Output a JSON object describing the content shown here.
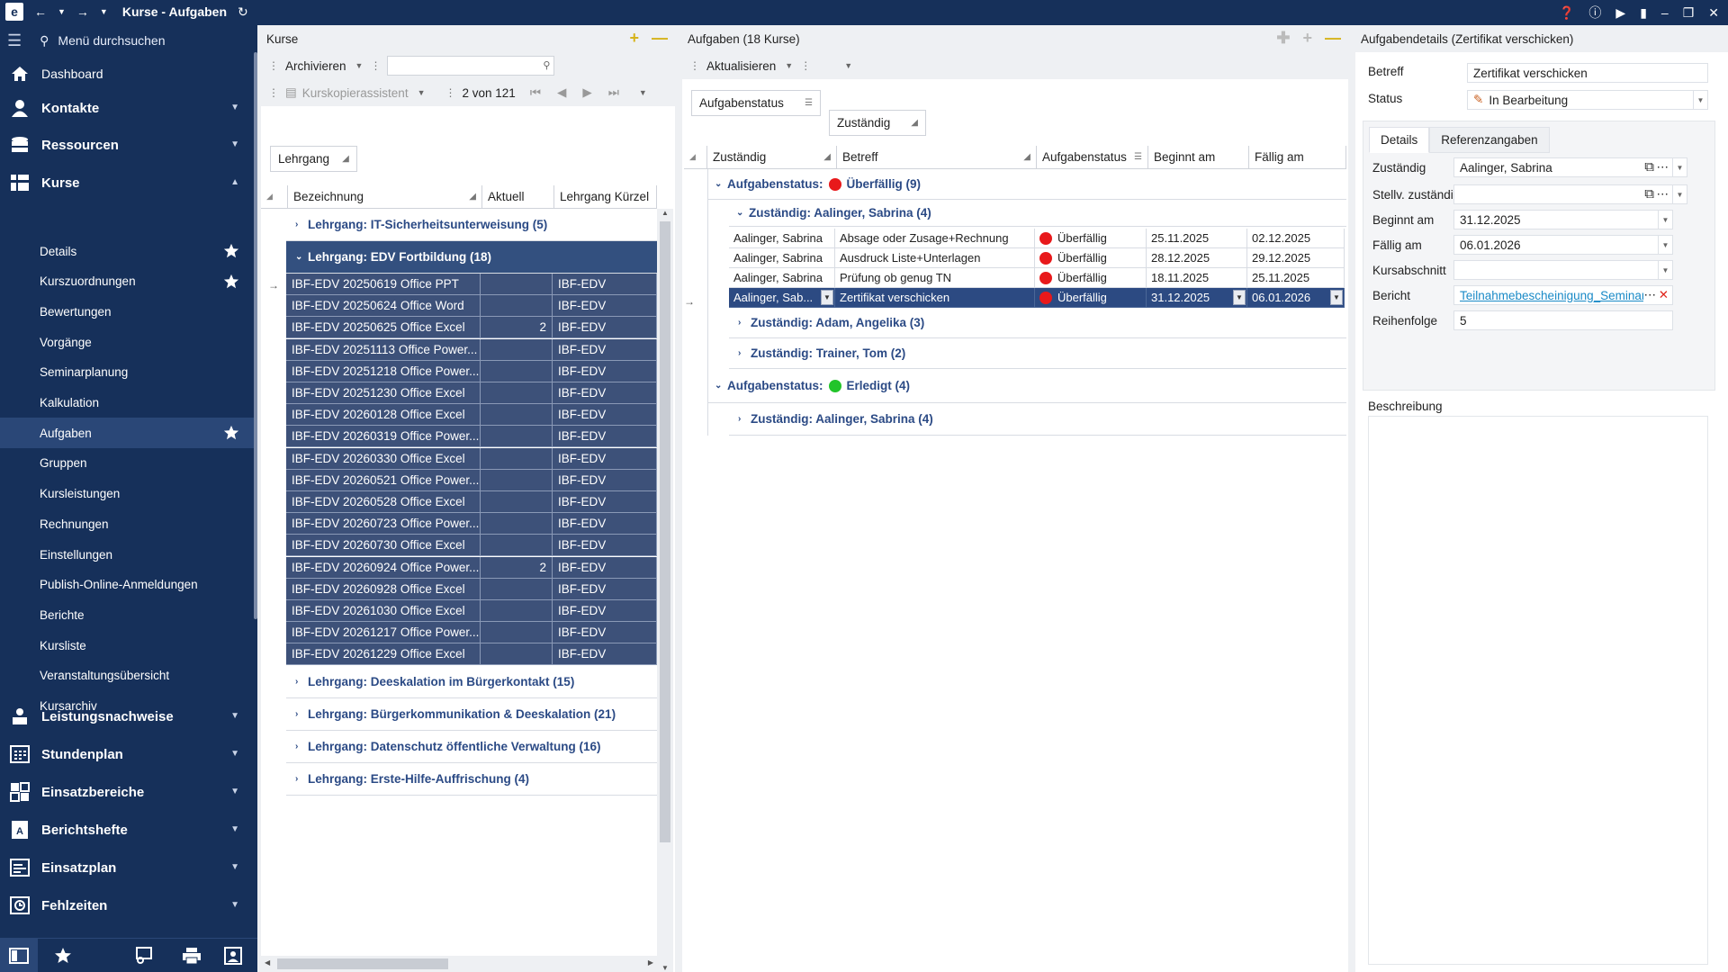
{
  "window": {
    "title": "Kurse - Aufgaben",
    "logo": "e"
  },
  "sidebar": {
    "search_label": "Menü durchsuchen",
    "dashboard": "Dashboard",
    "main_items": [
      {
        "label": "Kontakte",
        "icon": "contact-icon"
      },
      {
        "label": "Ressourcen",
        "icon": "database-icon"
      },
      {
        "label": "Kurse",
        "icon": "courses-icon"
      },
      {
        "label": "Leistungsnachweise",
        "icon": "certificate-icon"
      },
      {
        "label": "Stundenplan",
        "icon": "calendar-icon"
      },
      {
        "label": "Einsatzbereiche",
        "icon": "grid-icon"
      },
      {
        "label": "Berichtshefte",
        "icon": "report-book-icon"
      },
      {
        "label": "Einsatzplan",
        "icon": "plan-icon"
      },
      {
        "label": "Fehlzeiten",
        "icon": "absence-icon"
      }
    ],
    "sub_items": [
      "Details",
      "Kurszuordnungen",
      "Bewertungen",
      "Vorgänge",
      "Seminarplanung",
      "Kalkulation",
      "Aufgaben",
      "Gruppen",
      "Kursleistungen",
      "Rechnungen",
      "Einstellungen",
      "Publish-Online-Anmeldungen",
      "Berichte",
      "Kursliste",
      "Veranstaltungsübersicht",
      "Kursarchiv"
    ]
  },
  "kurse": {
    "title": "Kurse",
    "archive_btn": "Archivieren",
    "search_placeholder": "",
    "copy_assistant": "Kurskopierassistent",
    "pager": "2 von 121",
    "group_chip": "Lehrgang",
    "columns": [
      "Bezeichnung",
      "Aktuell",
      "Lehrgang Kürzel"
    ],
    "groups_top": [
      "Lehrgang: IT-Sicherheitsunterweisung (5)",
      "Lehrgang: EDV Fortbildung (18)"
    ],
    "rows": [
      {
        "name": "IBF-EDV 20250619 Office PPT",
        "aktuell": "",
        "kuerzel": "IBF-EDV"
      },
      {
        "name": "IBF-EDV 20250624 Office Word",
        "aktuell": "",
        "kuerzel": "IBF-EDV"
      },
      {
        "name": "IBF-EDV 20250625 Office Excel",
        "aktuell": "2",
        "kuerzel": "IBF-EDV"
      },
      {
        "name": "IBF-EDV 20251113 Office Power...",
        "aktuell": "",
        "kuerzel": "IBF-EDV"
      },
      {
        "name": "IBF-EDV 20251218 Office Power...",
        "aktuell": "",
        "kuerzel": "IBF-EDV"
      },
      {
        "name": "IBF-EDV 20251230 Office Excel",
        "aktuell": "",
        "kuerzel": "IBF-EDV"
      },
      {
        "name": "IBF-EDV 20260128 Office Excel",
        "aktuell": "",
        "kuerzel": "IBF-EDV"
      },
      {
        "name": "IBF-EDV 20260319 Office Power...",
        "aktuell": "",
        "kuerzel": "IBF-EDV"
      },
      {
        "name": "IBF-EDV 20260330 Office Excel",
        "aktuell": "",
        "kuerzel": "IBF-EDV"
      },
      {
        "name": "IBF-EDV 20260521 Office Power...",
        "aktuell": "",
        "kuerzel": "IBF-EDV"
      },
      {
        "name": "IBF-EDV 20260528 Office Excel",
        "aktuell": "",
        "kuerzel": "IBF-EDV"
      },
      {
        "name": "IBF-EDV 20260723 Office Power...",
        "aktuell": "",
        "kuerzel": "IBF-EDV"
      },
      {
        "name": "IBF-EDV 20260730 Office Excel",
        "aktuell": "",
        "kuerzel": "IBF-EDV"
      },
      {
        "name": "IBF-EDV 20260924 Office Power...",
        "aktuell": "2",
        "kuerzel": "IBF-EDV"
      },
      {
        "name": "IBF-EDV 20260928 Office Excel",
        "aktuell": "",
        "kuerzel": "IBF-EDV"
      },
      {
        "name": "IBF-EDV 20261030 Office Excel",
        "aktuell": "",
        "kuerzel": "IBF-EDV"
      },
      {
        "name": "IBF-EDV 20261217 Office Power...",
        "aktuell": "",
        "kuerzel": "IBF-EDV"
      },
      {
        "name": "IBF-EDV 20261229 Office Excel",
        "aktuell": "",
        "kuerzel": "IBF-EDV"
      }
    ],
    "groups_bottom": [
      "Lehrgang: Deeskalation im Bürgerkontakt (15)",
      "Lehrgang: Bürgerkommunikation & Deeskalation (21)",
      "Lehrgang: Datenschutz öffentliche Verwaltung (16)",
      "Lehrgang: Erste-Hilfe-Auffrischung (4)"
    ]
  },
  "aufgaben": {
    "title": "Aufgaben (18 Kurse)",
    "refresh_btn": "Aktualisieren",
    "group_chips": [
      "Aufgabenstatus",
      "Zuständig"
    ],
    "columns": [
      "Zuständig",
      "Betreff",
      "Aufgabenstatus",
      "Beginnt am",
      "Fällig am"
    ],
    "group_overdue": "Aufgabenstatus:",
    "overdue_label": "Überfällig (9)",
    "sub_aalinger": "Zuständig: Aalinger, Sabrina (4)",
    "rows": [
      {
        "who": "Aalinger, Sabrina",
        "subject": "Absage oder Zusage+Rechnung",
        "status": "Überfällig",
        "start": "25.11.2025",
        "due": "02.12.2025"
      },
      {
        "who": "Aalinger, Sabrina",
        "subject": "Ausdruck Liste+Unterlagen",
        "status": "Überfällig",
        "start": "28.12.2025",
        "due": "29.12.2025"
      },
      {
        "who": "Aalinger, Sabrina",
        "subject": "Prüfung ob genug TN",
        "status": "Überfällig",
        "start": "18.11.2025",
        "due": "25.11.2025"
      },
      {
        "who": "Aalinger, Sab...",
        "subject": "Zertifikat verschicken",
        "status": "Überfällig",
        "start": "31.12.2025",
        "due": "06.01.2026"
      }
    ],
    "sub_adam": "Zuständig: Adam, Angelika (3)",
    "sub_trainer": "Zuständig: Trainer, Tom (2)",
    "group_done": "Aufgabenstatus:",
    "done_label": "Erledigt (4)",
    "sub_done_aalinger": "Zuständig: Aalinger, Sabrina (4)",
    "colors": {
      "overdue": "#e8191b",
      "done": "#22c42a"
    }
  },
  "details": {
    "title": "Aufgabendetails (Zertifikat verschicken)",
    "betreff_label": "Betreff",
    "betreff_value": "Zertifikat verschicken",
    "status_label": "Status",
    "status_value": "In Bearbeitung",
    "tabs": [
      "Details",
      "Referenzangaben"
    ],
    "fields": {
      "zustaendig_label": "Zuständig",
      "zustaendig_value": "Aalinger, Sabrina",
      "stellv_label": "Stellv. zuständig",
      "stellv_value": "",
      "beginnt_label": "Beginnt am",
      "beginnt_value": "31.12.2025",
      "faellig_label": "Fällig am",
      "faellig_value": "06.01.2026",
      "abschnitt_label": "Kursabschnitt",
      "abschnitt_value": "",
      "bericht_label": "Bericht",
      "bericht_value": "Teilnahmebescheinigung_Seminar",
      "reihenfolge_label": "Reihenfolge",
      "reihenfolge_value": "5"
    },
    "beschreibung_label": "Beschreibung"
  },
  "theme": {
    "sidebar_bg": "#16305a",
    "accent_yellow": "#e6c21a",
    "selection": "#2c4a82"
  }
}
